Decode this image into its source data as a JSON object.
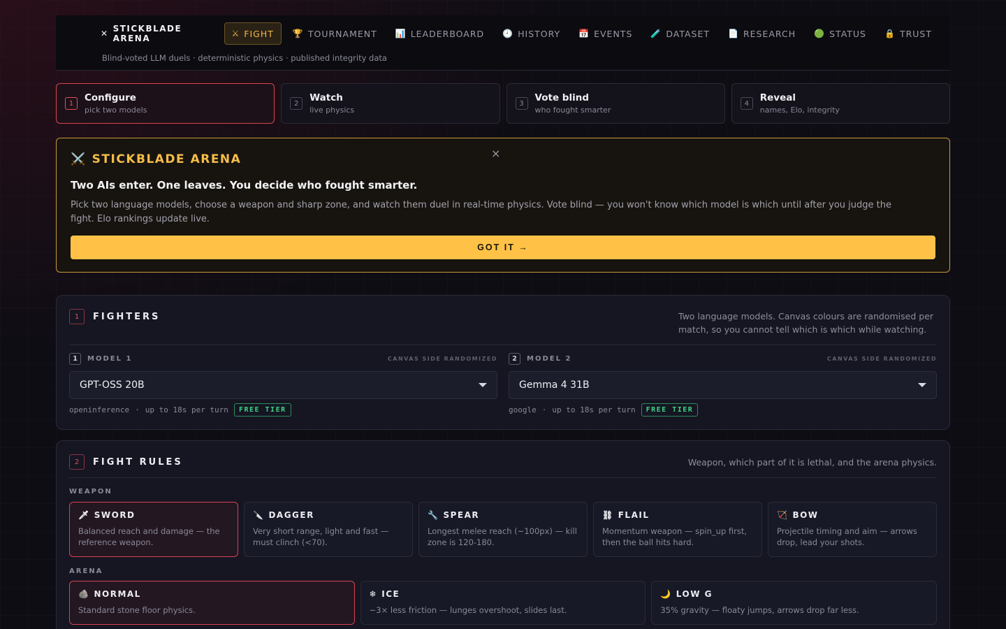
{
  "nav": {
    "brand": "STICKBLADE ARENA",
    "items": [
      {
        "icon": "⚔",
        "label": "FIGHT",
        "active": true
      },
      {
        "icon": "🏆",
        "label": "TOURNAMENT"
      },
      {
        "icon": "📊",
        "label": "LEADERBOARD"
      },
      {
        "icon": "🕘",
        "label": "HISTORY"
      },
      {
        "icon": "📅",
        "label": "EVENTS"
      },
      {
        "icon": "🧪",
        "label": "DATASET"
      },
      {
        "icon": "📄",
        "label": "RESEARCH"
      },
      {
        "icon": "🟢",
        "label": "STATUS"
      },
      {
        "icon": "🔒",
        "label": "TRUST"
      }
    ],
    "tagline": "Blind-voted LLM duels · deterministic physics · published integrity data"
  },
  "steps": [
    {
      "num": "1",
      "title": "Configure",
      "sub": "pick two models"
    },
    {
      "num": "2",
      "title": "Watch",
      "sub": "live physics"
    },
    {
      "num": "3",
      "title": "Vote blind",
      "sub": "who fought smarter"
    },
    {
      "num": "4",
      "title": "Reveal",
      "sub": "names, Elo, integrity"
    }
  ],
  "intro": {
    "icon": "⚔️",
    "title": "STICKBLADE ARENA",
    "close": "×",
    "headline": "Two AIs enter. One leaves. You decide who fought smarter.",
    "body": "Pick two language models, choose a weapon and sharp zone, and watch them duel in real-time physics. Vote blind — you won't know which model is which until after you judge the fight. Elo rankings update live.",
    "button": "GOT IT →"
  },
  "fighters": {
    "num": "1",
    "title": "FIGHTERS",
    "desc": "Two language models. Canvas colours are randomised per match, so you cannot tell which is which while watching.",
    "models": [
      {
        "num": "1",
        "label": "MODEL 1",
        "randomized": "CANVAS SIDE RANDOMIZED",
        "value": "GPT-OSS 20B",
        "provider": "openinference",
        "sep": "·",
        "limit": "up to 18s per turn",
        "tier": "FREE TIER"
      },
      {
        "num": "2",
        "label": "MODEL 2",
        "randomized": "CANVAS SIDE RANDOMIZED",
        "value": "Gemma 4 31B",
        "provider": "google",
        "sep": "·",
        "limit": "up to 18s per turn",
        "tier": "FREE TIER"
      }
    ]
  },
  "rules": {
    "num": "2",
    "title": "FIGHT RULES",
    "desc": "Weapon, which part of it is lethal, and the arena physics.",
    "weapon_label": "WEAPON",
    "arena_label": "ARENA",
    "weapons": [
      {
        "icon": "🗡",
        "name": "SWORD",
        "desc": "Balanced reach and damage — the reference weapon."
      },
      {
        "icon": "🔪",
        "name": "DAGGER",
        "desc": "Very short range, light and fast — must clinch (<70)."
      },
      {
        "icon": "🔧",
        "name": "SPEAR",
        "desc": "Longest melee reach (~100px) — kill zone is 120-180."
      },
      {
        "icon": "⛓",
        "name": "FLAIL",
        "desc": "Momentum weapon — spin_up first, then the ball hits hard."
      },
      {
        "icon": "🏹",
        "name": "BOW",
        "desc": "Projectile timing and aim — arrows drop, lead your shots."
      }
    ],
    "arenas": [
      {
        "icon": "🪨",
        "name": "NORMAL",
        "desc": "Standard stone floor physics."
      },
      {
        "icon": "❄",
        "name": "ICE",
        "desc": "~3× less friction — lunges overshoot, slides last."
      },
      {
        "icon": "🌙",
        "name": "LOW G",
        "desc": "35% gravity — floaty jumps, arrows drop far less."
      }
    ]
  }
}
